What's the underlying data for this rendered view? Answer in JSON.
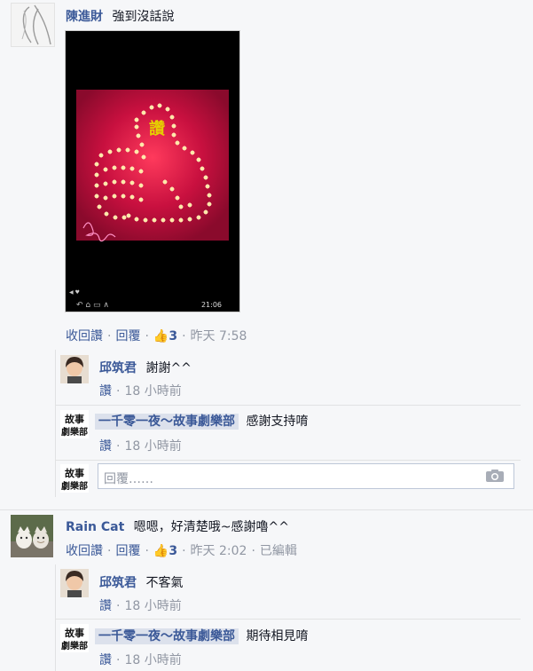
{
  "comments": [
    {
      "author": "陳進財",
      "text": "強到沒話說",
      "photo_label": "讚",
      "photo_status_time": "21:06",
      "actions": {
        "unlike": "收回讚",
        "reply": "回覆",
        "likes": "3",
        "time_word": "昨天",
        "time": "7:58"
      },
      "replies": [
        {
          "author": "邱筑君",
          "text": "謝謝^^",
          "like": "讚",
          "time_num": "18",
          "time_unit": "小時前"
        },
        {
          "author": "一千零一夜～故事劇樂部",
          "text": "感謝支持唷",
          "like": "讚",
          "time_num": "18",
          "time_unit": "小時前"
        }
      ],
      "reply_input_placeholder": "回覆……"
    },
    {
      "author": "Rain Cat",
      "text": "嗯嗯，好清楚哦~感謝嚕^^",
      "actions": {
        "unlike": "收回讚",
        "reply": "回覆",
        "likes": "3",
        "time_word": "昨天",
        "time": "2:02",
        "edited": "已編輯"
      },
      "replies": [
        {
          "author": "邱筑君",
          "text": "不客氣",
          "like": "讚",
          "time_num": "18",
          "time_unit": "小時前"
        },
        {
          "author": "一千零一夜～故事劇樂部",
          "text": "期待相見唷",
          "like": "讚",
          "time_num": "18",
          "time_unit": "小時前"
        }
      ]
    }
  ],
  "colors": {
    "link": "#3b5998",
    "muted": "#9197a3",
    "background": "#f6f7f9",
    "pink_photo": "#d0124a"
  },
  "icons": [
    "like-thumb-icon",
    "camera-icon"
  ]
}
